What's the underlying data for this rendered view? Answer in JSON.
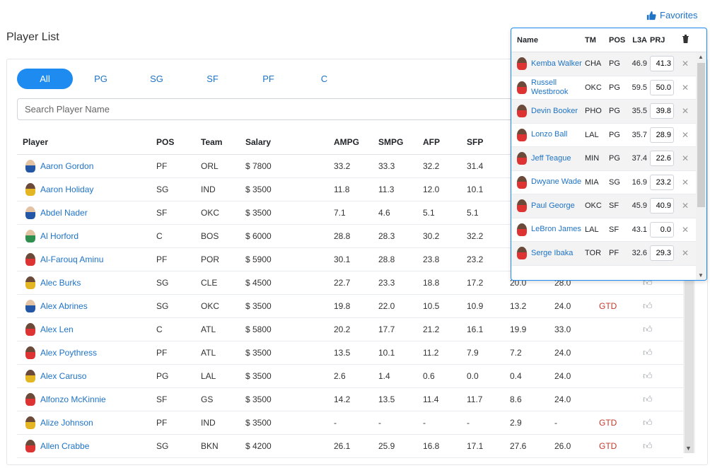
{
  "page": {
    "title": "Player List",
    "favorites_label": "Favorites"
  },
  "tabs": [
    "All",
    "PG",
    "SG",
    "SF",
    "PF",
    "C"
  ],
  "search": {
    "placeholder": "Search Player Name"
  },
  "table": {
    "headers": [
      "Player",
      "POS",
      "Team",
      "Salary",
      "AMPG",
      "SMPG",
      "AFP",
      "SFP",
      "",
      "",
      "",
      ""
    ],
    "rows": [
      {
        "name": "Aaron Gordon",
        "pos": "PF",
        "team": "ORL",
        "salary": "$ 7800",
        "ampg": "33.2",
        "smpg": "33.3",
        "afp": "32.2",
        "sfp": "31.4",
        "c9": "",
        "c10": "",
        "status": ""
      },
      {
        "name": "Aaron Holiday",
        "pos": "SG",
        "team": "IND",
        "salary": "$ 3500",
        "ampg": "11.8",
        "smpg": "11.3",
        "afp": "12.0",
        "sfp": "10.1",
        "c9": "",
        "c10": "",
        "status": ""
      },
      {
        "name": "Abdel Nader",
        "pos": "SF",
        "team": "OKC",
        "salary": "$ 3500",
        "ampg": "7.1",
        "smpg": "4.6",
        "afp": "5.1",
        "sfp": "5.1",
        "c9": "",
        "c10": "",
        "status": ""
      },
      {
        "name": "Al Horford",
        "pos": "C",
        "team": "BOS",
        "salary": "$ 6000",
        "ampg": "28.8",
        "smpg": "28.3",
        "afp": "30.2",
        "sfp": "32.2",
        "c9": "",
        "c10": "",
        "status": ""
      },
      {
        "name": "Al-Farouq Aminu",
        "pos": "PF",
        "team": "POR",
        "salary": "$ 5900",
        "ampg": "30.1",
        "smpg": "28.8",
        "afp": "23.8",
        "sfp": "23.2",
        "c9": "",
        "c10": "",
        "status": ""
      },
      {
        "name": "Alec Burks",
        "pos": "SG",
        "team": "CLE",
        "salary": "$ 4500",
        "ampg": "22.7",
        "smpg": "23.3",
        "afp": "18.8",
        "sfp": "17.2",
        "c9": "20.0",
        "c10": "28.0",
        "status": ""
      },
      {
        "name": "Alex Abrines",
        "pos": "SG",
        "team": "OKC",
        "salary": "$ 3500",
        "ampg": "19.8",
        "smpg": "22.0",
        "afp": "10.5",
        "sfp": "10.9",
        "c9": "13.2",
        "c10": "24.0",
        "status": "GTD"
      },
      {
        "name": "Alex Len",
        "pos": "C",
        "team": "ATL",
        "salary": "$ 5800",
        "ampg": "20.2",
        "smpg": "17.7",
        "afp": "21.2",
        "sfp": "16.1",
        "c9": "19.9",
        "c10": "33.0",
        "status": ""
      },
      {
        "name": "Alex Poythress",
        "pos": "PF",
        "team": "ATL",
        "salary": "$ 3500",
        "ampg": "13.5",
        "smpg": "10.1",
        "afp": "11.2",
        "sfp": "7.9",
        "c9": "7.2",
        "c10": "24.0",
        "status": ""
      },
      {
        "name": "Alex Caruso",
        "pos": "PG",
        "team": "LAL",
        "salary": "$ 3500",
        "ampg": "2.6",
        "smpg": "1.4",
        "afp": "0.6",
        "sfp": "0.0",
        "c9": "0.4",
        "c10": "24.0",
        "status": ""
      },
      {
        "name": "Alfonzo McKinnie",
        "pos": "SF",
        "team": "GS",
        "salary": "$ 3500",
        "ampg": "14.2",
        "smpg": "13.5",
        "afp": "11.4",
        "sfp": "11.7",
        "c9": "8.6",
        "c10": "24.0",
        "status": ""
      },
      {
        "name": "Alize Johnson",
        "pos": "PF",
        "team": "IND",
        "salary": "$ 3500",
        "ampg": "-",
        "smpg": "-",
        "afp": "-",
        "sfp": "-",
        "c9": "2.9",
        "c10": "-",
        "status": "GTD"
      },
      {
        "name": "Allen Crabbe",
        "pos": "SG",
        "team": "BKN",
        "salary": "$ 4200",
        "ampg": "26.1",
        "smpg": "25.9",
        "afp": "16.8",
        "sfp": "17.1",
        "c9": "27.6",
        "c10": "26.0",
        "status": "GTD"
      }
    ]
  },
  "favorites": {
    "headers": {
      "name": "Name",
      "tm": "TM",
      "pos": "POS",
      "l3a": "L3A",
      "prj": "PRJ"
    },
    "rows": [
      {
        "name": "Kemba Walker",
        "tm": "CHA",
        "pos": "PG",
        "l3a": "46.9",
        "prj": "41.3"
      },
      {
        "name": "Russell Westbrook",
        "tm": "OKC",
        "pos": "PG",
        "l3a": "59.5",
        "prj": "50.0"
      },
      {
        "name": "Devin Booker",
        "tm": "PHO",
        "pos": "PG",
        "l3a": "35.5",
        "prj": "39.8"
      },
      {
        "name": "Lonzo Ball",
        "tm": "LAL",
        "pos": "PG",
        "l3a": "35.7",
        "prj": "28.9"
      },
      {
        "name": "Jeff Teague",
        "tm": "MIN",
        "pos": "PG",
        "l3a": "37.4",
        "prj": "22.6"
      },
      {
        "name": "Dwyane Wade",
        "tm": "MIA",
        "pos": "SG",
        "l3a": "16.9",
        "prj": "23.2"
      },
      {
        "name": "Paul George",
        "tm": "OKC",
        "pos": "SF",
        "l3a": "45.9",
        "prj": "40.9"
      },
      {
        "name": "LeBron James",
        "tm": "LAL",
        "pos": "SF",
        "l3a": "43.1",
        "prj": "0.0"
      },
      {
        "name": "Serge Ibaka",
        "tm": "TOR",
        "pos": "PF",
        "l3a": "32.6",
        "prj": "29.3"
      }
    ]
  }
}
